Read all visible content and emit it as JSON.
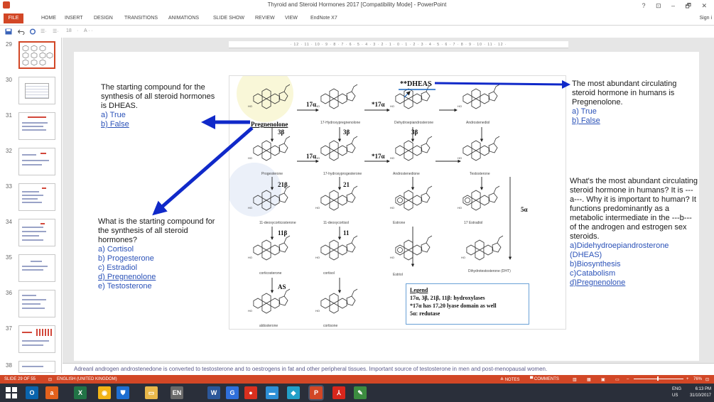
{
  "window": {
    "title": "Thyroid and Steroid Hormones 2017 [Compatibility Mode] - PowerPoint",
    "controls": "? ⊡ – 🗗 ✕"
  },
  "ribbon": {
    "file": "FILE",
    "tabs": [
      "HOME",
      "INSERT",
      "DESIGN",
      "TRANSITIONS",
      "ANIMATIONS",
      "SLIDE SHOW",
      "REVIEW",
      "VIEW",
      "EndNote X7"
    ],
    "sign_in": "Sign i"
  },
  "qat": {
    "font_size": "18"
  },
  "ruler": "· 12 · 11 · 10 · 9 · 8 · 7 · 6 · 5 · 4 · 3 · 2 · 1 · 0 · 1 · 2 · 3 · 4 · 5 · 6 · 7 · 8 · 9 · 10 · 11 · 12 ·",
  "thumbnails": [
    {
      "num": "29",
      "selected": true
    },
    {
      "num": "30",
      "selected": false
    },
    {
      "num": "31",
      "selected": false
    },
    {
      "num": "32",
      "selected": false
    },
    {
      "num": "33",
      "selected": false
    },
    {
      "num": "34",
      "selected": false
    },
    {
      "num": "35",
      "selected": false
    },
    {
      "num": "36",
      "selected": false
    },
    {
      "num": "37",
      "selected": false
    },
    {
      "num": "38",
      "selected": false
    }
  ],
  "slide": {
    "q1": {
      "text": "The starting compound for the synthesis of all steroid hormones is DHEAS.",
      "a": "a) True",
      "b": "b) False"
    },
    "q2": {
      "text": "What is the starting compound for the synthesis of all steroid hormones?",
      "options": [
        "a) Cortisol",
        "b) Progesterone",
        "c) Estradiol",
        "d) Pregnenolone",
        "e) Testosterone"
      ]
    },
    "q3": {
      "text": "The most abundant circulating steroid hormone in humans is Pregnenolone.",
      "a": "a) True",
      "b": "b) False"
    },
    "q4": {
      "text": "What's the most abundant circulating steroid hormone in humans? It is ---a---. Why it is important to human? It functions predominantly as a metabolic intermediate in the ---b--- of the androgen and estrogen sex steroids.",
      "options": [
        "a)Didehydroepiandrosterone (DHEAS)",
        "b)Biosynthesis",
        "c)Catabolism",
        "d)Pregnenolone"
      ]
    },
    "diagram": {
      "labels": {
        "pregnenolone": "Pregnenolone",
        "hydroxypregnenolone": "17-Hydroxypregnenolone",
        "dhea": "Dehydroepiandrosterone",
        "androstenediol": "Androstenediol",
        "progesterone": "Progesterone",
        "hydroxyprogesterone": "17-hydroxyprogesterone",
        "androstenedione": "Androstenedione",
        "testosterone": "Testosterone",
        "deoxycorticosterone": "11-deoxycorticosterone",
        "deoxycortisol": "11-deoxycortisol",
        "estrone": "Estrone",
        "estradiol": "17 Estradiol",
        "corticosterone": "corticosterone",
        "cortisol": "cortisol",
        "estriol": "Estriol",
        "dht": "Dihydrotestosterone (DHT)",
        "aldosterone": "aldosterone",
        "cortisone": "cortisone",
        "dheas": "**DHEAS"
      },
      "enzymes": {
        "e17a_1": "17α",
        "e17a_2": "*17α",
        "e17a_3": "17α",
        "e17a_4": "*17α",
        "e3b_1": "3β",
        "e3b_2": "3β",
        "e3b_3": "3β",
        "e21b": "21β",
        "e21": "21",
        "e11b": "11β",
        "e11": "11",
        "eAS": "AS",
        "e5a": "5α"
      },
      "legend": {
        "title": "Legend",
        "lines": [
          "17α, 3β, 21β, 11β: hydroxylases",
          "*17α has 17,20 lyase domain as well",
          "5α: redutase"
        ]
      }
    }
  },
  "notes": {
    "text": "Adreanl androgen androstenedone is converted to testosterone and to oestrogens in fat and other peripheral tissues. Important source of testosterone in men and post-menopausal women."
  },
  "status": {
    "slide": "SLIDE 29 OF 55",
    "language": "ENGLISH (UNITED KINGDOM)",
    "notes": "≜ NOTES",
    "comments": "▀ COMMENTS",
    "zoom": "76%"
  },
  "taskbar": {
    "apps": [
      {
        "name": "outlook",
        "label": "O",
        "color": "#0a64ad"
      },
      {
        "name": "office",
        "label": "a",
        "color": "#e3611c"
      },
      {
        "name": "excel",
        "label": "X",
        "color": "#217346"
      },
      {
        "name": "chrome",
        "label": "◉",
        "color": "#f2b416"
      },
      {
        "name": "defender",
        "label": "⛊",
        "color": "#1f6fd1"
      },
      {
        "name": "explorer",
        "label": "▭",
        "color": "#e8b84a"
      },
      {
        "name": "endnote",
        "label": "EN",
        "color": "#6a6a6a"
      },
      {
        "name": "word",
        "label": "W",
        "color": "#2b579a"
      },
      {
        "name": "g-app",
        "label": "G",
        "color": "#2f6fdb"
      },
      {
        "name": "circle-app",
        "label": "●",
        "color": "#d9301f"
      },
      {
        "name": "monitor-app",
        "label": "▬",
        "color": "#2d8fd6"
      },
      {
        "name": "network-app",
        "label": "◆",
        "color": "#22a0c8"
      },
      {
        "name": "powerpoint",
        "label": "P",
        "color": "#d24726"
      },
      {
        "name": "acrobat",
        "label": "⅄",
        "color": "#d8261c"
      },
      {
        "name": "paint",
        "label": "✎",
        "color": "#3c8c40"
      }
    ],
    "lang": "ENG\nUS",
    "time": "6:13 PM",
    "date": "31/10/2017"
  }
}
